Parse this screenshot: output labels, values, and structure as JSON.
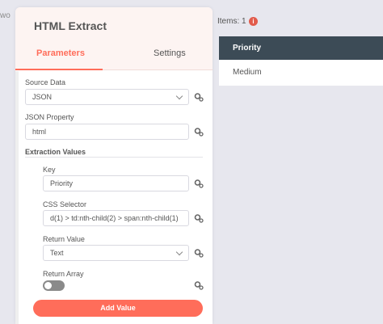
{
  "background_hint": "wo",
  "panel": {
    "title": "HTML Extract",
    "tabs": [
      {
        "label": "Parameters",
        "active": true
      },
      {
        "label": "Settings",
        "active": false
      }
    ]
  },
  "fields": {
    "source_data": {
      "label": "Source Data",
      "value": "JSON"
    },
    "json_property": {
      "label": "JSON Property",
      "value": "html"
    },
    "extraction_values_title": "Extraction Values",
    "key": {
      "label": "Key",
      "value": "Priority"
    },
    "css_selector": {
      "label": "CSS Selector",
      "value": "d(1) > td:nth-child(2) > span:nth-child(1)"
    },
    "return_value": {
      "label": "Return Value",
      "value": "Text"
    },
    "return_array": {
      "label": "Return Array",
      "value": false
    },
    "add_value_label": "Add Value"
  },
  "output": {
    "items_label": "Items: 1",
    "info_icon": "i",
    "columns": [
      "Priority"
    ],
    "rows": [
      [
        "Medium"
      ]
    ]
  },
  "colors": {
    "accent": "#ff6d5a",
    "table_header": "#3c4b56",
    "info": "#e25b4b"
  },
  "icons": [
    "gear-icon",
    "chevron-down-icon",
    "info-icon"
  ]
}
